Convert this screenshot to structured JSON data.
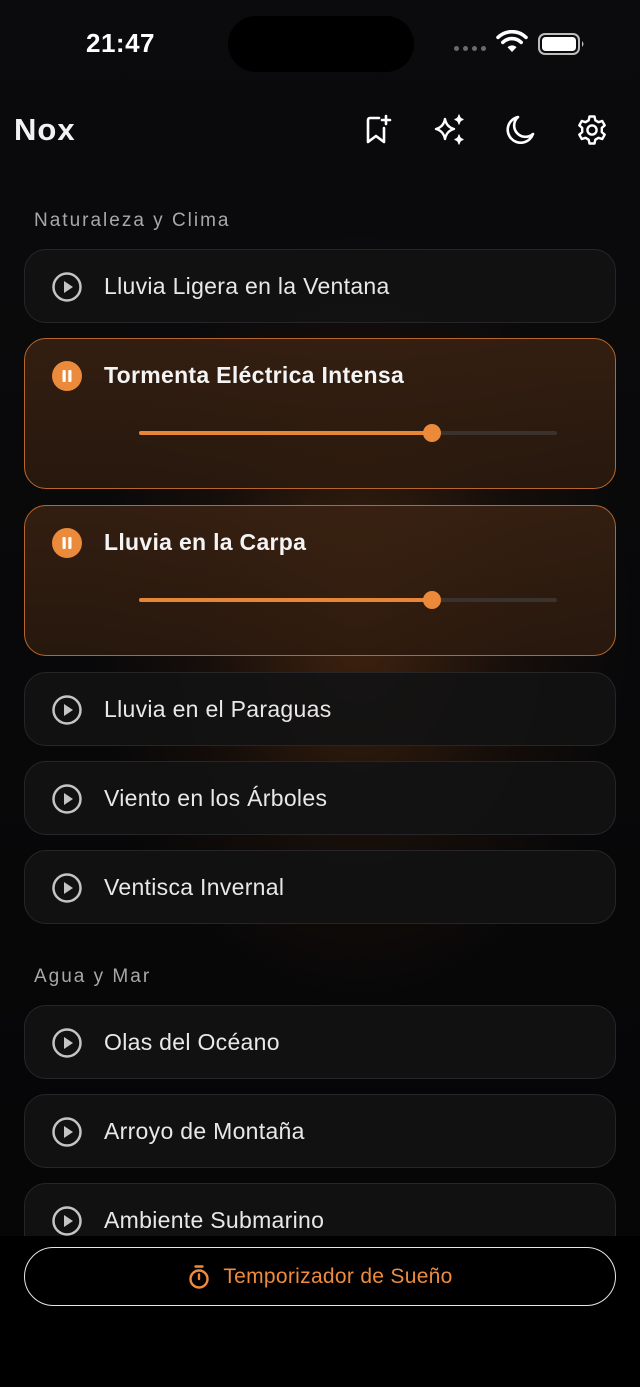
{
  "status": {
    "time": "21:47"
  },
  "header": {
    "title": "Nox",
    "icons": [
      "bookmark-add-icon",
      "sparkles-icon",
      "moon-icon",
      "gear-icon"
    ]
  },
  "accent": "#e88637",
  "sections": [
    {
      "title": "Naturaleza y Clima",
      "items": [
        {
          "label": "Lluvia Ligera en la Ventana",
          "playing": false
        },
        {
          "label": "Tormenta Eléctrica Intensa",
          "playing": true,
          "volume": 0.7
        },
        {
          "label": "Lluvia en la Carpa",
          "playing": true,
          "volume": 0.7
        },
        {
          "label": "Lluvia en el Paraguas",
          "playing": false
        },
        {
          "label": "Viento en los Árboles",
          "playing": false
        },
        {
          "label": "Ventisca Invernal",
          "playing": false
        }
      ]
    },
    {
      "title": "Agua y Mar",
      "items": [
        {
          "label": "Olas del Océano",
          "playing": false
        },
        {
          "label": "Arroyo de Montaña",
          "playing": false
        },
        {
          "label": "Ambiente Submarino",
          "playing": false
        }
      ]
    }
  ],
  "footer": {
    "timer_label": "Temporizador de Sueño"
  }
}
